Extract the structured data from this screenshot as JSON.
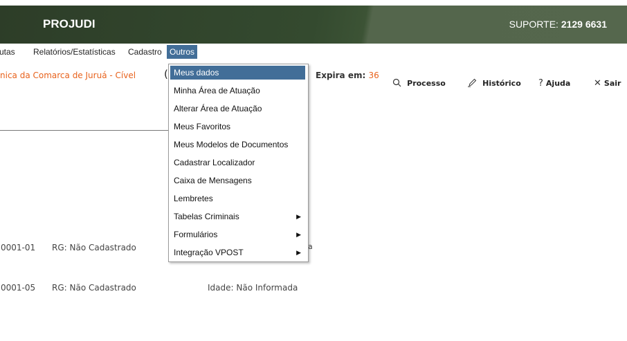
{
  "header": {
    "brand": "PROJUDI",
    "support_label": "SUPORTE:",
    "support_number": "2129 6631",
    "colors": {
      "header_dark": "#2d3d28",
      "header_light": "#55674d"
    }
  },
  "menubar": {
    "items": [
      {
        "label": "utas"
      },
      {
        "label": "Relatórios/Estatísticas"
      },
      {
        "label": "Cadastro"
      },
      {
        "label": "Outros"
      }
    ],
    "active_color": "#426e98"
  },
  "info": {
    "court": "nica da Comarca de Juruá - Cível",
    "court_extra": "(",
    "expira_label": "Expira em:",
    "expira_value": "36"
  },
  "toolbar": {
    "processo": {
      "label": "Processo",
      "icon": "search-icon"
    },
    "historico": {
      "label": "Histórico",
      "icon": "pencil-icon"
    },
    "ajuda": {
      "label": "Ajuda",
      "icon": "question-icon"
    },
    "sair": {
      "label": "Sair",
      "icon": "close-icon"
    }
  },
  "rows": [
    {
      "id": "0001-01",
      "rg": "RG: Não Cadastrado",
      "idade": "a"
    },
    {
      "id": "0001-05",
      "rg": "RG: Não Cadastrado",
      "idade": "Idade: Não Informada"
    }
  ],
  "dropdown": {
    "items": [
      {
        "label": "Meus dados",
        "submenu": false,
        "selected": true
      },
      {
        "label": "Minha Área de Atuação",
        "submenu": false
      },
      {
        "label": "Alterar Área de Atuação",
        "submenu": false
      },
      {
        "label": "Meus Favoritos",
        "submenu": false
      },
      {
        "label": "Meus Modelos de Documentos",
        "submenu": false
      },
      {
        "label": "Cadastrar Localizador",
        "submenu": false
      },
      {
        "label": "Caixa de Mensagens",
        "submenu": false
      },
      {
        "label": "Lembretes",
        "submenu": false
      },
      {
        "label": "Tabelas Criminais",
        "submenu": true
      },
      {
        "label": "Formulários",
        "submenu": true
      },
      {
        "label": "Integração VPOST",
        "submenu": true
      }
    ],
    "submenu_arrow": "▶"
  }
}
